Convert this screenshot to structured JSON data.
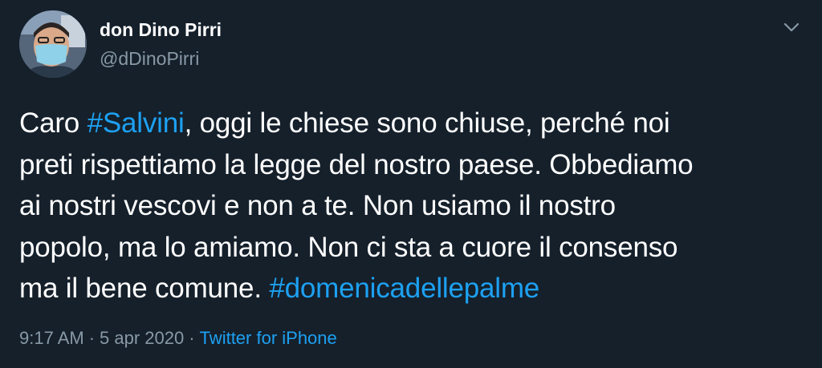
{
  "author": {
    "display_name": "don Dino Pirri",
    "handle": "@dDinoPirri"
  },
  "icons": {
    "more": "chevron-down-icon",
    "avatar": "profile-photo"
  },
  "tweet": {
    "lines": [
      [
        {
          "text": "Caro "
        },
        {
          "text": "#Salvini",
          "hashtag": true
        },
        {
          "text": ", oggi le chiese sono chiuse, perché noi"
        }
      ],
      [
        {
          "text": "preti rispettiamo la legge del nostro paese.  Obbediamo"
        }
      ],
      [
        {
          "text": "ai nostri vescovi e non a te. Non usiamo il nostro"
        }
      ],
      [
        {
          "text": "popolo, ma lo amiamo. Non ci sta a cuore il consenso"
        }
      ],
      [
        {
          "text": "ma il bene comune. "
        },
        {
          "text": "#domenicadellepalme",
          "hashtag": true
        }
      ]
    ]
  },
  "meta": {
    "time": "9:17 AM",
    "date": "5 apr 2020",
    "separator": "·",
    "source": "Twitter for iPhone"
  },
  "colors": {
    "background": "#15202b",
    "text": "#ffffff",
    "secondary": "#8899a6",
    "link": "#1da1f2"
  }
}
